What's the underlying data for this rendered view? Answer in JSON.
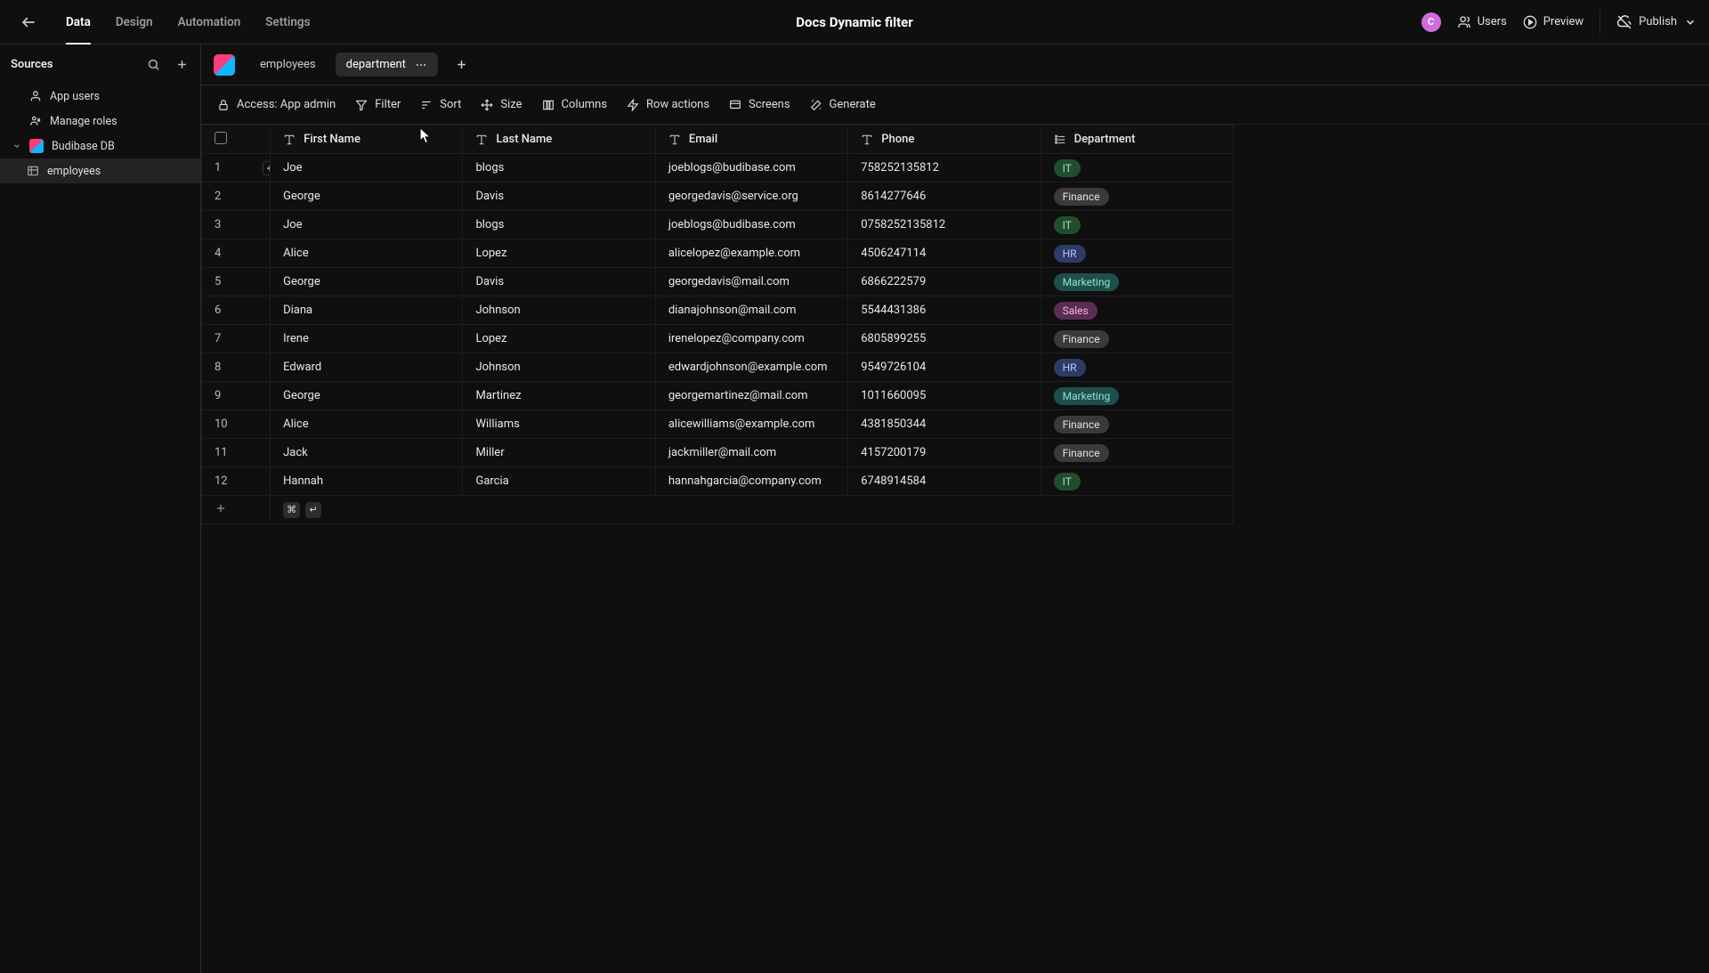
{
  "app_title": "Docs Dynamic filter",
  "nav": {
    "tabs": [
      "Data",
      "Design",
      "Automation",
      "Settings"
    ],
    "active_index": 0
  },
  "topbar": {
    "avatar_initial": "C",
    "users_label": "Users",
    "preview_label": "Preview",
    "publish_label": "Publish"
  },
  "sidebar": {
    "title": "Sources",
    "items": {
      "app_users": "App users",
      "manage_roles": "Manage roles",
      "db_name": "Budibase DB",
      "table_name": "employees"
    }
  },
  "tabstrip": {
    "tabs": [
      {
        "label": "employees",
        "active": false
      },
      {
        "label": "department",
        "active": true
      }
    ]
  },
  "toolbar": {
    "access_label": "Access: App admin",
    "filter": "Filter",
    "sort": "Sort",
    "size": "Size",
    "columns": "Columns",
    "row_actions": "Row actions",
    "screens": "Screens",
    "generate": "Generate"
  },
  "columns": [
    {
      "key": "first_name",
      "label": "First Name",
      "type": "text"
    },
    {
      "key": "last_name",
      "label": "Last Name",
      "type": "text"
    },
    {
      "key": "email",
      "label": "Email",
      "type": "text"
    },
    {
      "key": "phone",
      "label": "Phone",
      "type": "text"
    },
    {
      "key": "department",
      "label": "Department",
      "type": "select"
    }
  ],
  "rows": [
    {
      "first_name": "Joe",
      "last_name": "blogs",
      "email": "joeblogs@budibase.com",
      "phone": "758252135812",
      "department": "IT"
    },
    {
      "first_name": "George",
      "last_name": "Davis",
      "email": "georgedavis@service.org",
      "phone": "8614277646",
      "department": "Finance"
    },
    {
      "first_name": "Joe",
      "last_name": "blogs",
      "email": "joeblogs@budibase.com",
      "phone": "0758252135812",
      "department": "IT"
    },
    {
      "first_name": "Alice",
      "last_name": "Lopez",
      "email": "alicelopez@example.com",
      "phone": "4506247114",
      "department": "HR"
    },
    {
      "first_name": "George",
      "last_name": "Davis",
      "email": "georgedavis@mail.com",
      "phone": "6866222579",
      "department": "Marketing"
    },
    {
      "first_name": "Diana",
      "last_name": "Johnson",
      "email": "dianajohnson@mail.com",
      "phone": "5544431386",
      "department": "Sales"
    },
    {
      "first_name": "Irene",
      "last_name": "Lopez",
      "email": "irenelopez@company.com",
      "phone": "6805899255",
      "department": "Finance"
    },
    {
      "first_name": "Edward",
      "last_name": "Johnson",
      "email": "edwardjohnson@example.com",
      "phone": "9549726104",
      "department": "HR"
    },
    {
      "first_name": "George",
      "last_name": "Martinez",
      "email": "georgemartinez@mail.com",
      "phone": "1011660095",
      "department": "Marketing"
    },
    {
      "first_name": "Alice",
      "last_name": "Williams",
      "email": "alicewilliams@example.com",
      "phone": "4381850344",
      "department": "Finance"
    },
    {
      "first_name": "Jack",
      "last_name": "Miller",
      "email": "jackmiller@mail.com",
      "phone": "4157200179",
      "department": "Finance"
    },
    {
      "first_name": "Hannah",
      "last_name": "Garcia",
      "email": "hannahgarcia@company.com",
      "phone": "6748914584",
      "department": "IT"
    }
  ],
  "addrow_keys": {
    "modifier": "⌘",
    "enter": "↵"
  }
}
